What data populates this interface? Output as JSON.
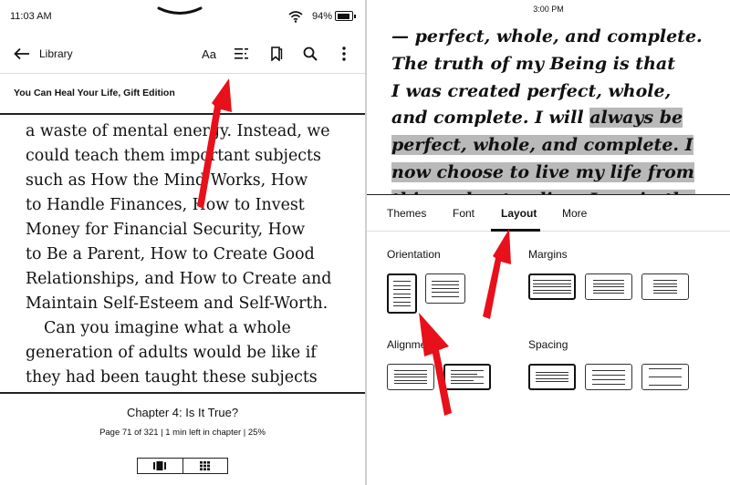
{
  "left": {
    "status": {
      "time": "11:03 AM",
      "battery": "94%",
      "battery_level": 0.94
    },
    "toolbar": {
      "back_label": "Library",
      "font_button": "Aa",
      "icons": [
        "back-arrow-icon",
        "contents-icon",
        "bookmark-icon",
        "search-icon",
        "more-vertical-icon"
      ]
    },
    "book_title": "You Can Heal Your Life, Gift Edition",
    "text_lines": [
      "a waste of mental energy. Instead, we",
      "could teach them important subjects",
      "such as How the Mind Works, How",
      "to Handle Finances, How to Invest",
      "Money for Financial Security, How",
      "to Be a Parent, How to Create Good",
      "Relationships, and How to Create and",
      "Maintain Self-Esteem and Self-Worth.",
      "Can you imagine what a whole",
      "generation of adults would be like if",
      "they had been taught these subjects"
    ],
    "chapter": "Chapter 4: Is It True?",
    "page_info": "Page 71 of 321 | 1 min left in chapter | 25%",
    "view_toggle_icons": [
      "page-flip-icon",
      "grid-icon"
    ]
  },
  "right": {
    "status": {
      "time": "3:00 PM"
    },
    "text_lines": [
      {
        "plain": "— perfect, whole, and complete.",
        "highlight": ""
      },
      {
        "plain": "The truth of my Being is that",
        "highlight": ""
      },
      {
        "plain": "I was created perfect, whole,",
        "highlight": ""
      },
      {
        "plain": "and complete. I will ",
        "highlight": "always be"
      },
      {
        "plain": "",
        "highlight": "perfect, whole, and complete. I"
      },
      {
        "plain": "",
        "highlight": "now choose to live my life from"
      },
      {
        "plain": "",
        "highlight": "this understanding. I am in the"
      }
    ],
    "tabs": [
      "Themes",
      "Font",
      "Layout",
      "More"
    ],
    "active_tab": "Layout",
    "sections": {
      "orientation": "Orientation",
      "margins": "Margins",
      "alignment": "Alignment",
      "spacing": "Spacing"
    }
  },
  "colors": {
    "highlight": "#b9b9b9",
    "annotation_arrow": "#e8101a"
  }
}
